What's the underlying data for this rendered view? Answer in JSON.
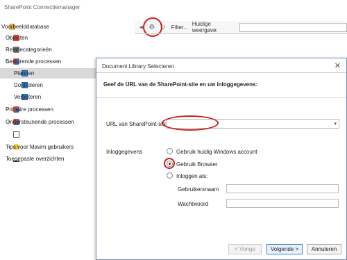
{
  "window": {
    "title": "SharePoint Connectiemanager"
  },
  "tree": {
    "items": [
      {
        "label": "Voorbeelddatabase",
        "chev": "",
        "icon": "database-icon"
      },
      {
        "label": "Objecten",
        "chev": "›",
        "icon": "objects-icon"
      },
      {
        "label": "Relatiecategorieën",
        "chev": "›",
        "icon": "relation-icon"
      },
      {
        "label": "Besturende processen",
        "chev": "⌄",
        "icon": "process-icon"
      },
      {
        "label": "Plannen",
        "chev": "›",
        "icon": "folder-icon"
      },
      {
        "label": "Controleren",
        "chev": "›",
        "icon": "folder-icon"
      },
      {
        "label": "Verbeteren",
        "chev": "›",
        "icon": "folder-icon"
      },
      {
        "label": "Primaire processen",
        "chev": "›",
        "icon": "process-icon"
      },
      {
        "label": "Ondersteunende processen",
        "chev": "›",
        "icon": "process-icon"
      },
      {
        "label": "",
        "chev": "",
        "icon": "calendar-icon"
      },
      {
        "label": "Tips voor Mavim gebruikers",
        "chev": "›",
        "icon": "lightbulb-icon"
      },
      {
        "label": "Toegepaste overzichten",
        "chev": "›",
        "icon": "chart-icon"
      }
    ]
  },
  "toolbar": {
    "filter_label": "Filter...",
    "view_label": "Huidige weergave:",
    "view_value": ""
  },
  "dialog": {
    "title": "Document Library Selecteren",
    "close": "✕",
    "heading": "Geef de URL van de SharePoint-site en uw inloggegevens:",
    "url_label": "URL van SharePoint-site",
    "url_value": "",
    "login_label": "Inloggegevens",
    "options": [
      {
        "label": "Gebruik huidig Windows account",
        "selected": false
      },
      {
        "label": "Gebruik Browser",
        "selected": true
      },
      {
        "label": "Inloggen als:",
        "selected": false
      }
    ],
    "username_label": "Gebruikersnaam",
    "username_value": "",
    "password_label": "Wachtwoord",
    "password_value": "",
    "buttons": {
      "prev": "< Vorige",
      "next": "Volgende >",
      "cancel": "Annuleren"
    }
  }
}
